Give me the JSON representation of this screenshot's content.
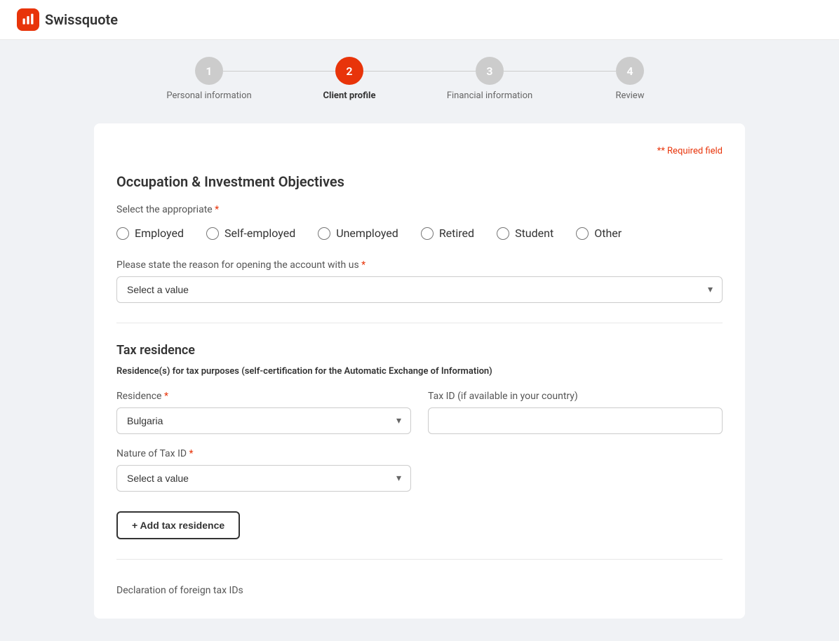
{
  "app": {
    "logo_text": "Swissquote"
  },
  "steps": [
    {
      "number": "1",
      "label": "Personal information",
      "state": "inactive"
    },
    {
      "number": "2",
      "label": "Client profile",
      "state": "active"
    },
    {
      "number": "3",
      "label": "Financial information",
      "state": "inactive"
    },
    {
      "number": "4",
      "label": "Review",
      "state": "inactive"
    }
  ],
  "form": {
    "required_note": "* Required field",
    "occupation_section": {
      "title": "Occupation & Investment Objectives",
      "select_label": "Select the appropriate",
      "required_star": "*",
      "employment_options": [
        {
          "id": "employed",
          "label": "Employed"
        },
        {
          "id": "self-employed",
          "label": "Self-employed"
        },
        {
          "id": "unemployed",
          "label": "Unemployed"
        },
        {
          "id": "retired",
          "label": "Retired"
        },
        {
          "id": "student",
          "label": "Student"
        },
        {
          "id": "other",
          "label": "Other"
        }
      ],
      "reason_label": "Please state the reason for opening the account with us",
      "reason_required": "*",
      "reason_placeholder": "Select a value"
    },
    "tax_section": {
      "title": "Tax residence",
      "note": "Residence(s) for tax purposes (self-certification for the Automatic Exchange of Information)",
      "residence_label": "Residence",
      "residence_required": "*",
      "residence_value": "Bulgaria",
      "tax_id_label": "Tax ID (if available in your country)",
      "tax_id_placeholder": "",
      "nature_label": "Nature of Tax ID",
      "nature_required": "*",
      "nature_placeholder": "Select a value",
      "add_btn_label": "+ Add tax residence"
    },
    "declaration_hint": "Declaration of foreign tax IDs"
  }
}
